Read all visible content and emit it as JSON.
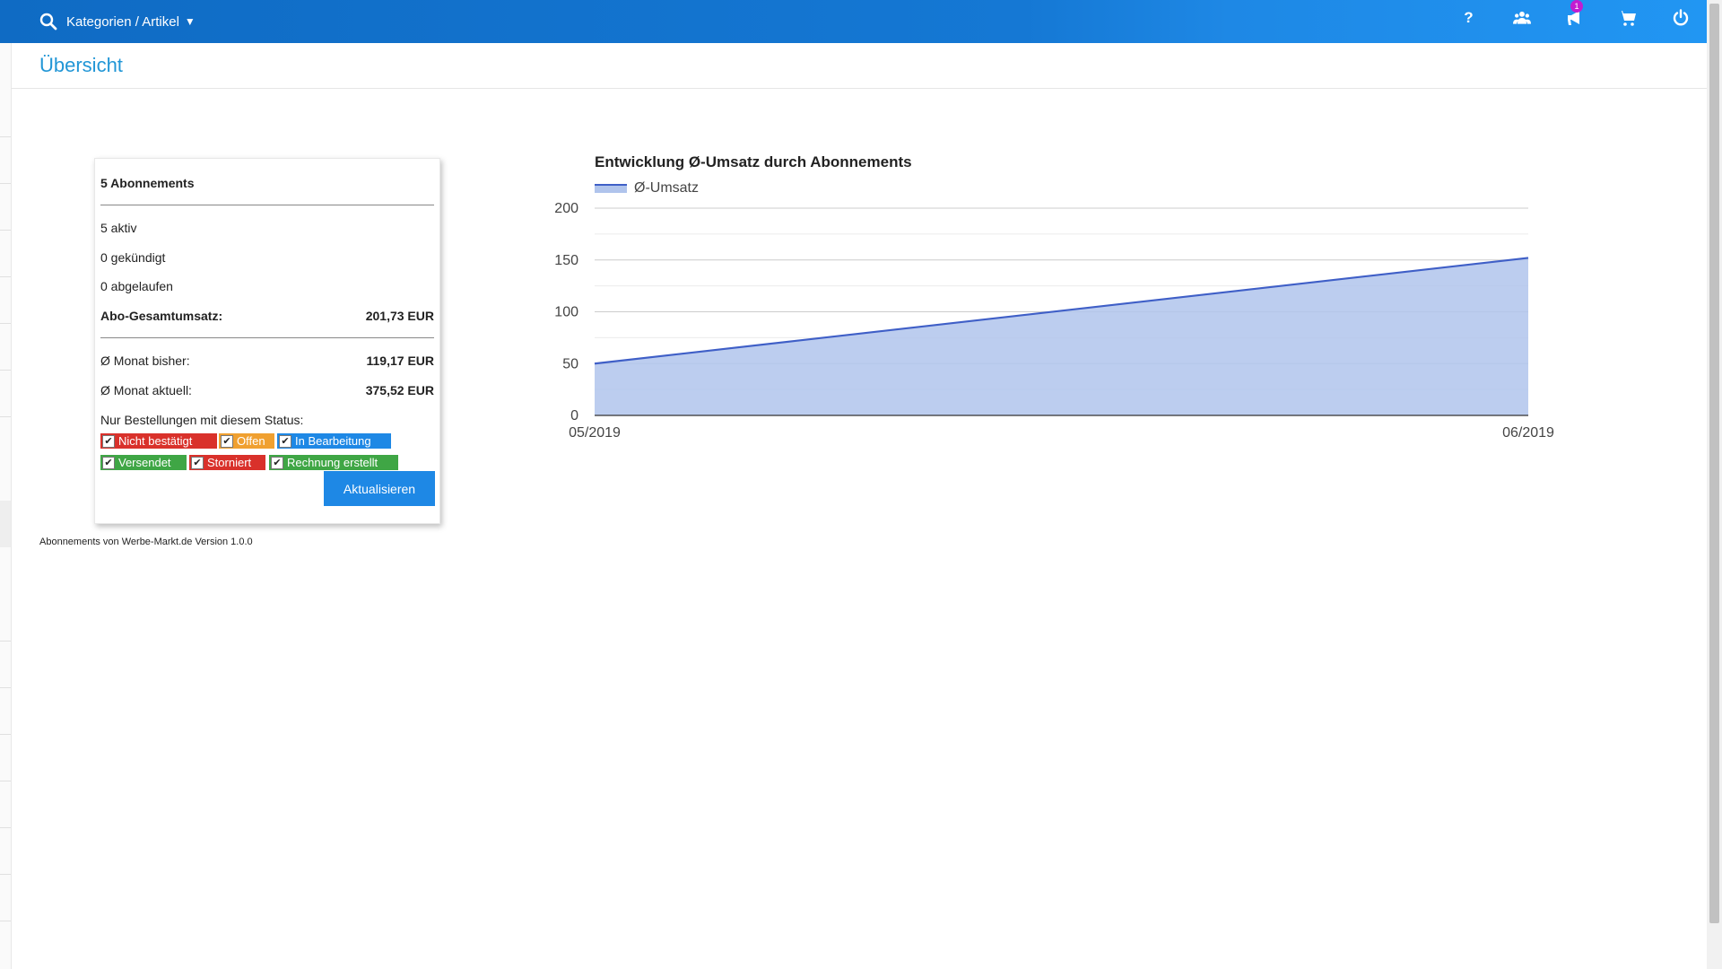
{
  "topbar": {
    "search_label": "Kategorien / Artikel",
    "caret": "▼",
    "notification_count": "1",
    "icons": [
      "help-icon",
      "users-icon",
      "megaphone-icon",
      "cart-icon",
      "power-icon"
    ],
    "help_glyph": "?"
  },
  "page": {
    "title": "Übersicht"
  },
  "stats": {
    "subscriptions": "5 Abonnements",
    "active": "5 aktiv",
    "cancelled": "0 gekündigt",
    "expired": "0 abgelaufen",
    "total_label": "Abo-Gesamtumsatz:",
    "total_value": "201,73 EUR",
    "avg_past_label": "Ø Monat bisher:",
    "avg_past_value": "119,17 EUR",
    "avg_current_label": "Ø Monat aktuell:",
    "avg_current_value": "375,52 EUR",
    "status_filter_label": "Nur Bestellungen mit diesem Status:",
    "statuses": [
      {
        "label": "Nicht bestätigt",
        "color": "#d9312b",
        "checked": true
      },
      {
        "label": "Offen",
        "color": "#f0a030",
        "checked": true
      },
      {
        "label": "In Bearbeitung",
        "color": "#1e88e5",
        "checked": true
      },
      {
        "label": "Versendet",
        "color": "#3fa645",
        "checked": true
      },
      {
        "label": "Storniert",
        "color": "#d9312b",
        "checked": true
      },
      {
        "label": "Rechnung erstellt",
        "color": "#3fa645",
        "checked": true
      }
    ],
    "update_button": "Aktualisieren"
  },
  "footer": {
    "text": "Abonnements von Werbe-Markt.de Version 1.0.0"
  },
  "chart_data": {
    "type": "area",
    "title": "Entwicklung Ø-Umsatz durch Abonnements",
    "categories": [
      "05/2019",
      "06/2019"
    ],
    "series": [
      {
        "name": "Ø-Umsatz",
        "values": [
          50,
          152
        ],
        "color": "#3f5fc7",
        "fill": "#b0c4ec"
      }
    ],
    "ylim": [
      0,
      200
    ],
    "yticks": [
      0,
      50,
      100,
      150,
      200
    ],
    "grid": true,
    "legend": "top-left"
  },
  "colors": {
    "topbar": "#1578d4",
    "accent": "#2196d6",
    "button": "#1e88e5"
  }
}
